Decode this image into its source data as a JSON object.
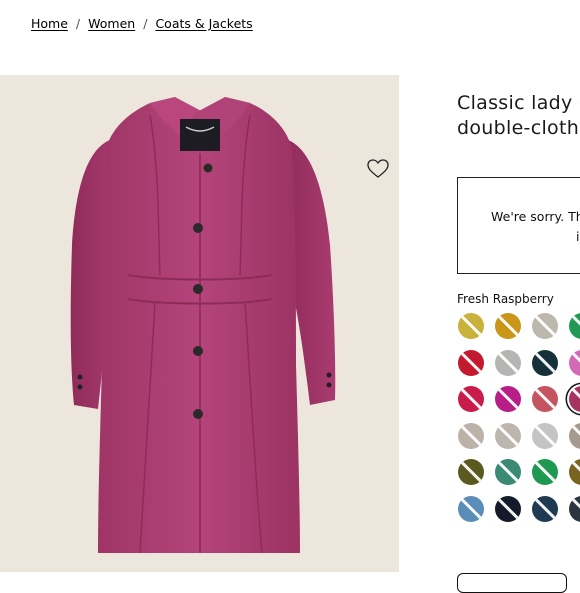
{
  "breadcrumb": {
    "items": [
      "Home",
      "Women",
      "Coats & Jackets"
    ],
    "separator": "/"
  },
  "product": {
    "title_line1": "Classic lady day",
    "title_line2": "double-cloth",
    "image_icon": "wool-coat-image",
    "wishlist_icon": "heart-outline-icon"
  },
  "notice": {
    "line1": "We're sorry. This",
    "line2": "i"
  },
  "color": {
    "selected_name": "Fresh Raspberry",
    "swatches": [
      {
        "color": "#c9b23c",
        "available": false
      },
      {
        "color": "#c9961a",
        "available": false
      },
      {
        "color": "#bdb8ae",
        "available": false
      },
      {
        "color": "#1f9a55",
        "available": false
      },
      {
        "color": "#c41a30",
        "available": false
      },
      {
        "color": "#b5b5b3",
        "available": false
      },
      {
        "color": "#17313a",
        "available": false
      },
      {
        "color": "#d46ab5",
        "available": false
      },
      {
        "color": "#c81d4a",
        "available": false
      },
      {
        "color": "#b81e86",
        "available": false
      },
      {
        "color": "#c55461",
        "available": false
      },
      {
        "color": "#a73460",
        "available": false,
        "selected": true
      },
      {
        "color": "#bcb2a8",
        "available": false
      },
      {
        "color": "#bcb6ae",
        "available": false
      },
      {
        "color": "#c4c4c4",
        "available": false
      },
      {
        "color": "#a49a8f",
        "available": false
      },
      {
        "color": "#5a5a20",
        "available": false
      },
      {
        "color": "#3a8a74",
        "available": false
      },
      {
        "color": "#1f9952",
        "available": false
      },
      {
        "color": "#7a6320",
        "available": false
      },
      {
        "color": "#5a8db8",
        "available": false
      },
      {
        "color": "#141a2a",
        "available": false
      },
      {
        "color": "#1f3a52",
        "available": false
      },
      {
        "color": "#2a3540",
        "available": false
      }
    ]
  }
}
